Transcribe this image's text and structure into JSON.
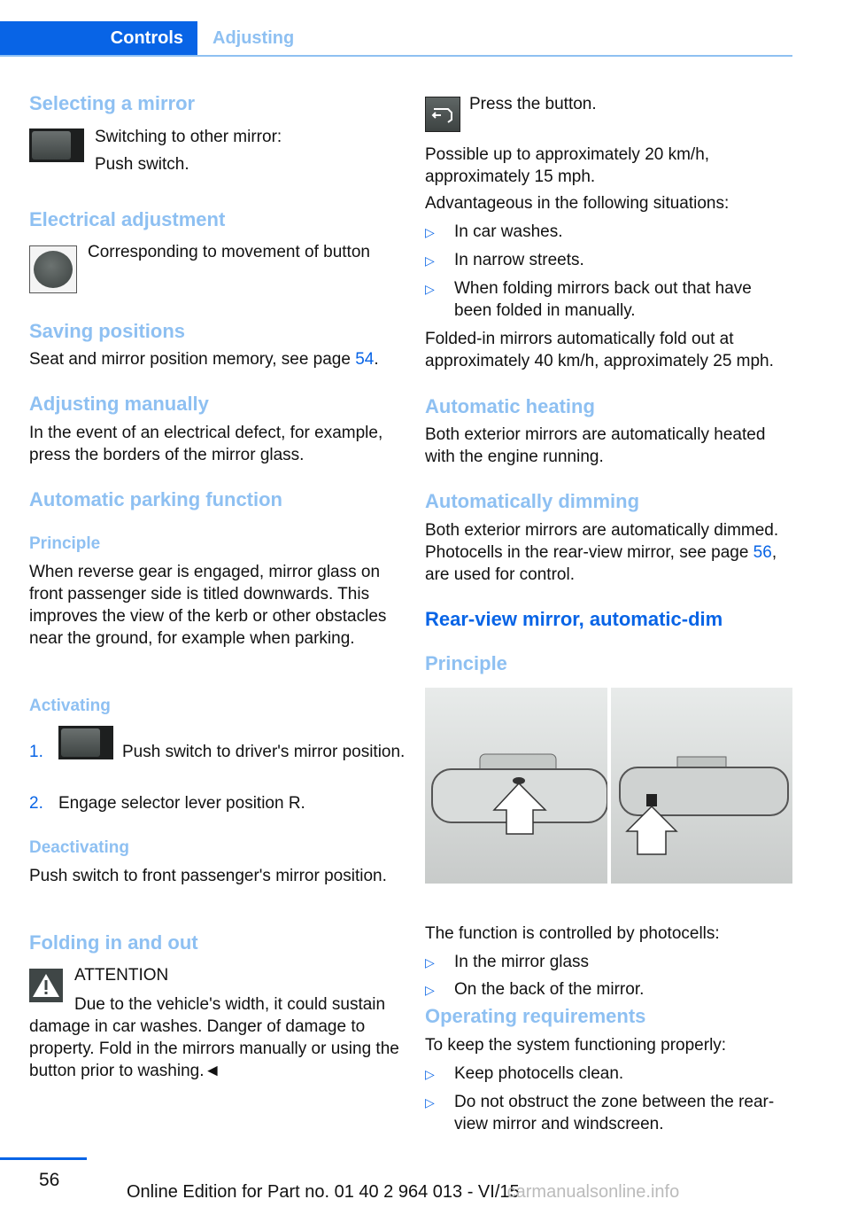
{
  "header": {
    "tab_active": "Controls",
    "tab_inactive": "Adjusting"
  },
  "left": {
    "selecting": {
      "title": "Selecting a mirror",
      "line1": "Switching to other mirror:",
      "line2": "Push switch."
    },
    "electrical": {
      "title": "Electrical adjustment",
      "text": "Corresponding to movement of button"
    },
    "saving": {
      "title": "Saving positions",
      "text": "Seat and mirror position memory, see page ",
      "page": "54",
      "end": "."
    },
    "manual": {
      "title": "Adjusting manually",
      "text": "In the event of an electrical defect, for example, press the borders of the mirror glass."
    },
    "parking": {
      "title": "Automatic parking function",
      "principle_title": "Principle",
      "principle_text": "When reverse gear is engaged, mirror glass on front passenger side is titled downwards. This improves the view of the kerb or other obstacles near the ground, for example when parking.",
      "activating_title": "Activating",
      "steps": [
        {
          "num": "1.",
          "text": "Push switch to driver's mirror position."
        },
        {
          "num": "2.",
          "text": "Engage selector lever position R."
        }
      ],
      "deactivating_title": "Deactivating",
      "deactivating_text": "Push switch to front passenger's mirror position."
    },
    "folding": {
      "title": "Folding in and out",
      "attention": "ATTENTION",
      "warning_text": "Due to the vehicle's width, it could sustain damage in car washes. Danger of damage to property. Fold in the mirrors manually or using the button prior to washing.◄"
    }
  },
  "right": {
    "press": "Press the button.",
    "possible": "Possible up to approximately 20 km/h, approximately 15 mph.",
    "advantageous": "Advantageous in the following situations:",
    "situations": [
      "In car washes.",
      "In narrow streets.",
      "When folding mirrors back out that have been folded in manually."
    ],
    "folded_out": "Folded-in mirrors automatically fold out at approximately 40 km/h, approximately 25 mph.",
    "heating_title": "Automatic heating",
    "heating_text": "Both exterior mirrors are automatically heated with the engine running.",
    "dimming_title": "Automatically dimming",
    "dimming_text": "Both exterior mirrors are automatically dimmed. Photocells in the rear-view mirror, see page ",
    "dimming_page": "56",
    "dimming_end": ", are used for control.",
    "rearview_title": "Rear-view mirror, automatic-dim",
    "principle_title": "Principle",
    "controlled": "The function is controlled by photocells:",
    "photocells": [
      "In the mirror glass",
      "On the back of the mirror."
    ],
    "operating_title": "Operating requirements",
    "operating_text": "To keep the system functioning properly:",
    "requirements": [
      "Keep photocells clean.",
      "Do not obstruct the zone between the rear-view mirror and windscreen."
    ]
  },
  "footer": {
    "page": "56",
    "edition": "Online Edition for Part no. 01 40 2 964 013 - VI/15",
    "watermark": "carmanualsonline.info"
  }
}
